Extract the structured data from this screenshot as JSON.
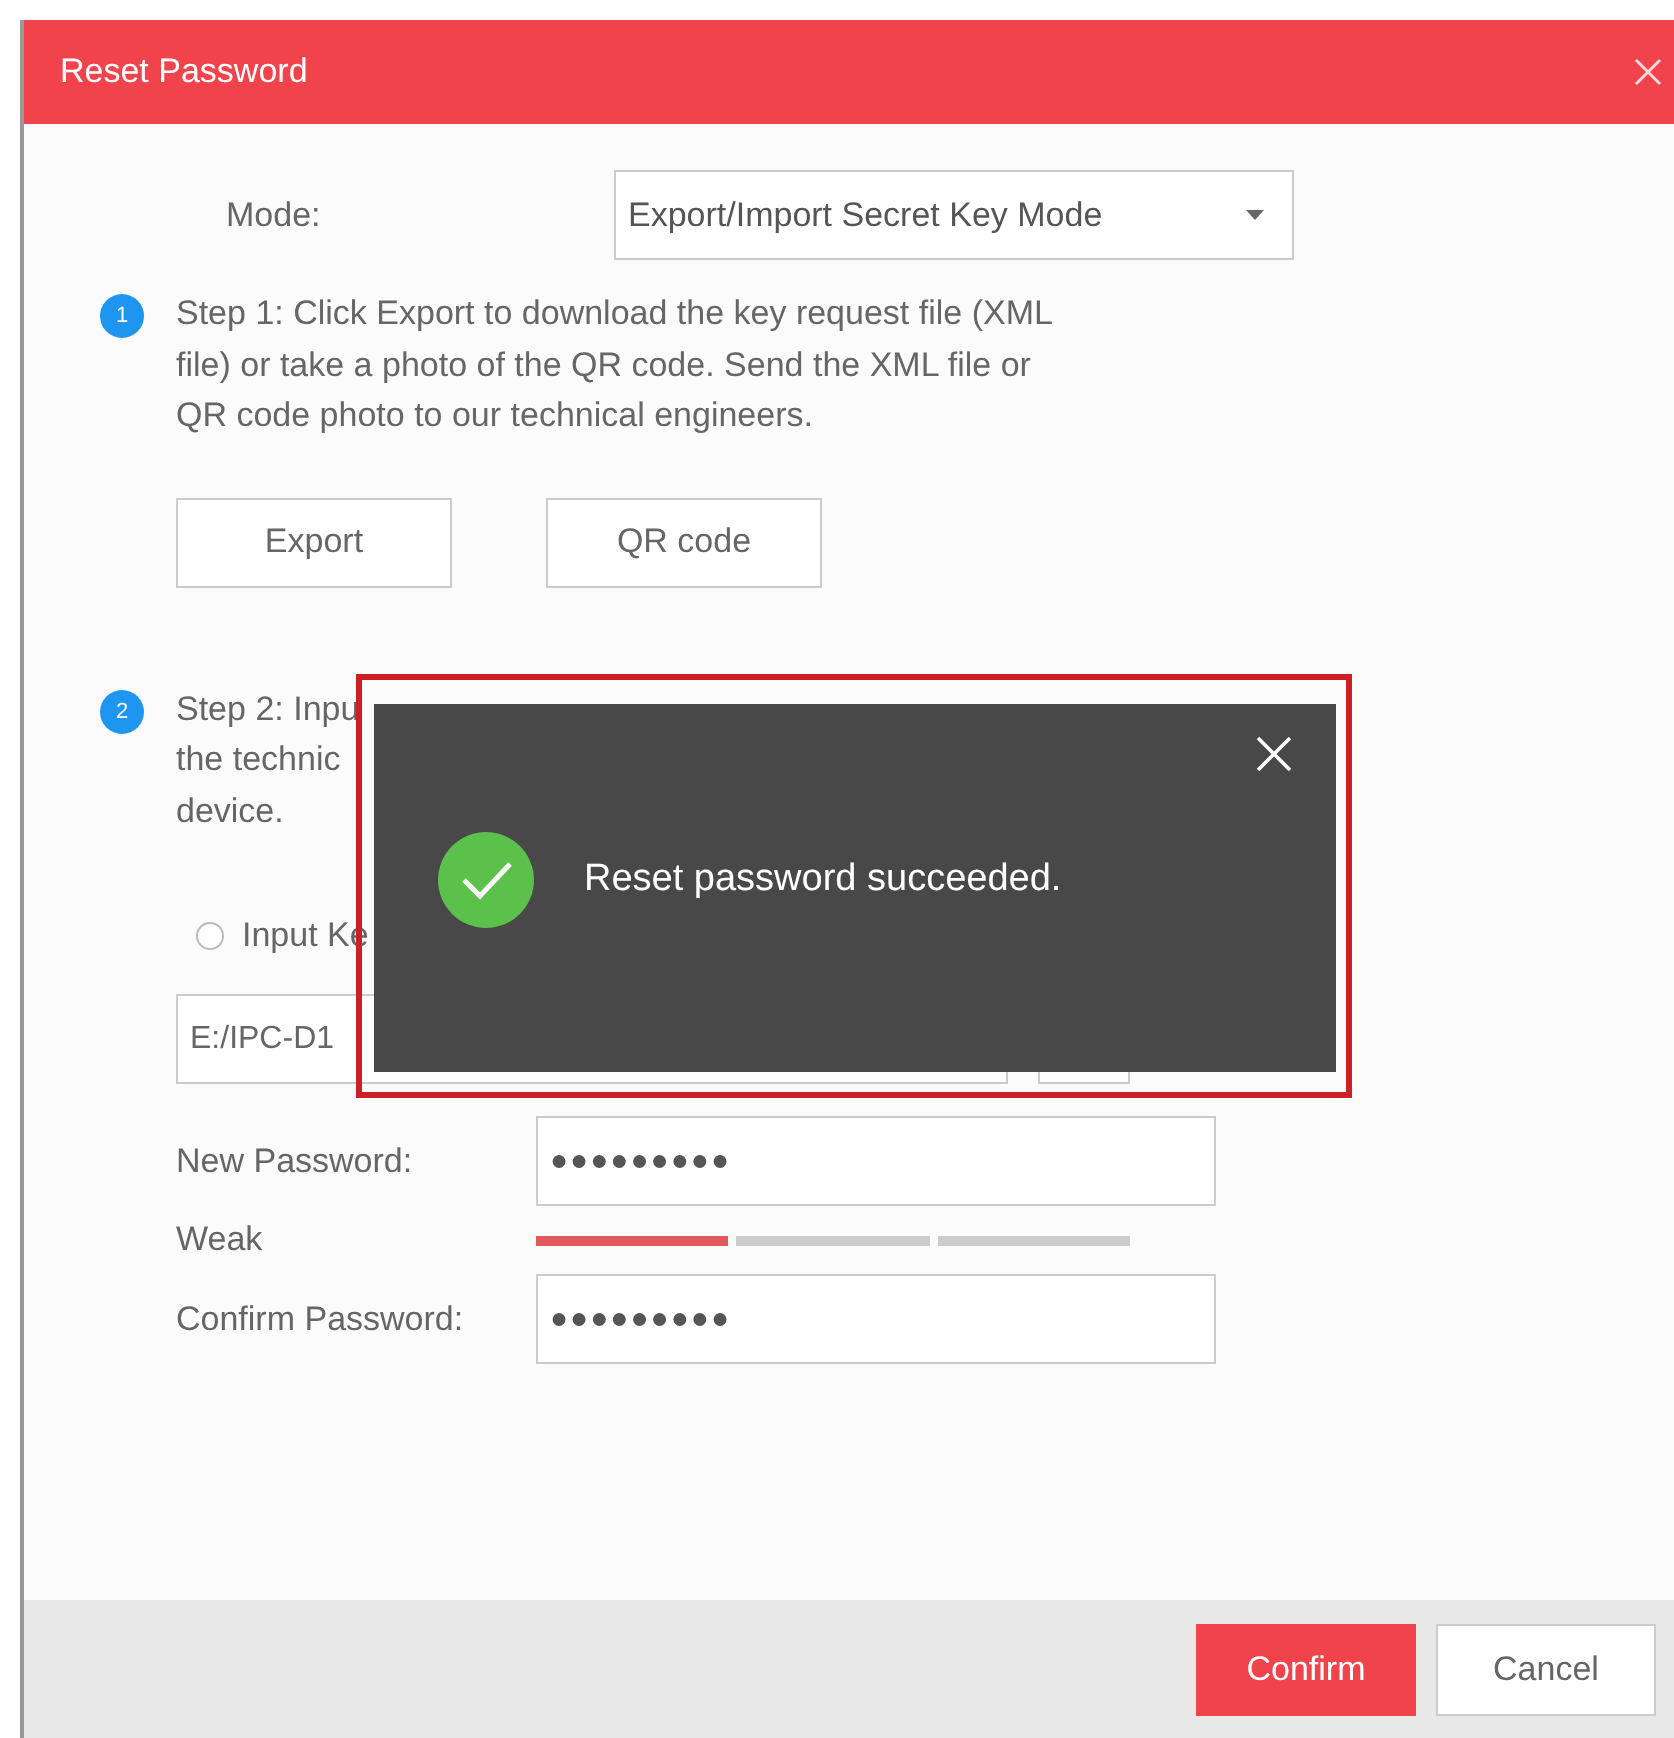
{
  "window": {
    "title": "Reset Password"
  },
  "mode": {
    "label": "Mode:",
    "value": "Export/Import Secret Key Mode"
  },
  "steps": [
    {
      "number": "1",
      "lines": [
        "Step 1: Click Export to download the key request file (XML",
        "file) or take a photo of the QR code. Send the XML file or",
        "QR code photo to our technical engineers."
      ]
    },
    {
      "number": "2",
      "lines": [
        "Step 2: Inpu",
        "the technic",
        "device."
      ]
    }
  ],
  "step1_buttons": [
    "Export",
    "QR code"
  ],
  "import_options": [
    {
      "label": "Input Ke",
      "selected": false
    }
  ],
  "file_path": {
    "value": "E:/IPC-D1"
  },
  "new_password": {
    "label": "New Password:",
    "value": "●●●●●●●●●"
  },
  "strength": {
    "label": "Weak",
    "segments": [
      {
        "filled": true
      },
      {
        "filled": false
      },
      {
        "filled": false
      }
    ]
  },
  "confirm_password": {
    "label": "Confirm Password:",
    "value": "●●●●●●●●●"
  },
  "buttons": [
    {
      "label": "Confirm",
      "kind": "primary"
    },
    {
      "label": "Cancel",
      "kind": "secondary"
    }
  ],
  "toast": {
    "message": "Reset password succeeded."
  }
}
